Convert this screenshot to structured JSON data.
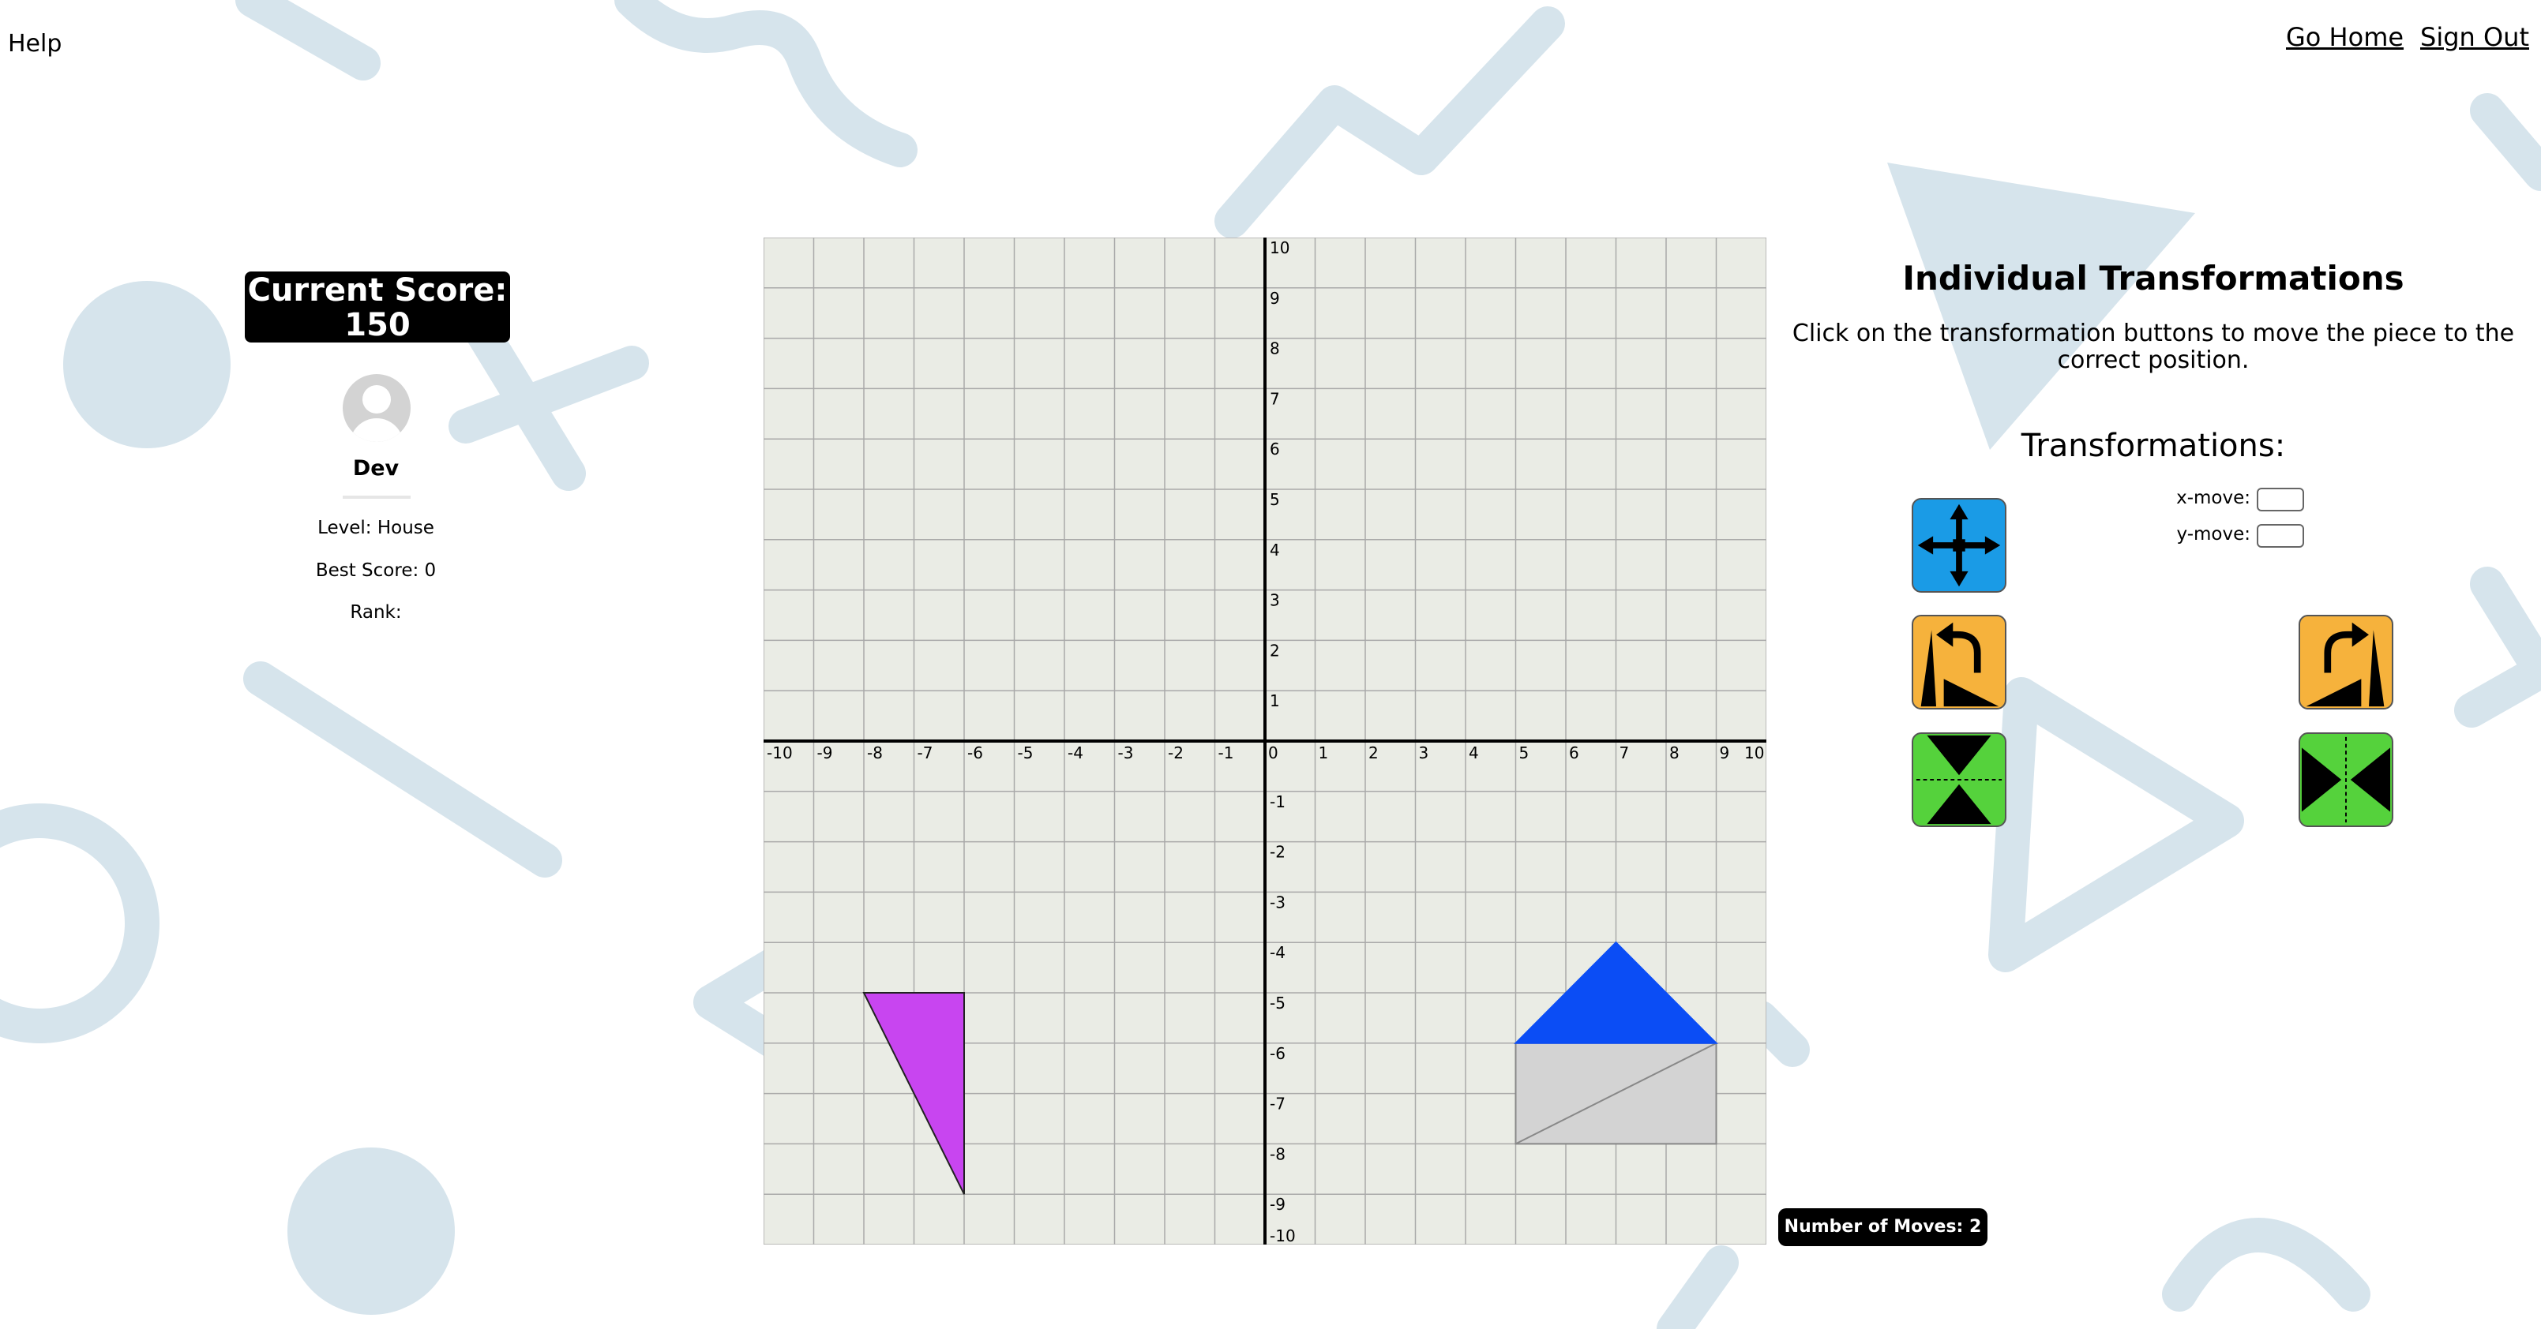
{
  "nav": {
    "help": "Help",
    "go_home": "Go Home",
    "sign_out": "Sign Out"
  },
  "player": {
    "score_title": "Current Score:",
    "score_value": "150",
    "name": "Dev",
    "level": "Level: House",
    "best_score": "Best Score: 0",
    "rank": "Rank:"
  },
  "panel": {
    "title": "Individual Transformations",
    "description": "Click on the transformation buttons to move the piece to the correct position.",
    "subtitle": "Transformations:",
    "x_move_label": "x-move:",
    "y_move_label": "y-move:",
    "x_move_value": "",
    "y_move_value": ""
  },
  "buttons": {
    "translate_icon": "move-arrows-icon",
    "rotate_ccw_icon": "rotate-left-icon",
    "rotate_cw_icon": "rotate-right-icon",
    "reflect_x_icon": "reflect-horizontal-axis-icon",
    "reflect_y_icon": "reflect-vertical-axis-icon",
    "translate_color": "#1a9be6",
    "rotate_color": "#f6b23c",
    "reflect_color": "#55d23c"
  },
  "moves": {
    "text": "Number of Moves: 2"
  },
  "board": {
    "x_range": [
      -10,
      10
    ],
    "y_range": [
      -10,
      10
    ],
    "grid_color": "#a9a9a9",
    "background": "#eaece5",
    "x_ticks": [
      "-10",
      "-9",
      "-8",
      "-7",
      "-6",
      "-5",
      "-4",
      "-3",
      "-2",
      "-1",
      "0",
      "1",
      "2",
      "3",
      "4",
      "5",
      "6",
      "7",
      "8",
      "9",
      "10"
    ],
    "y_ticks": [
      "10",
      "9",
      "8",
      "7",
      "6",
      "5",
      "4",
      "3",
      "2",
      "1",
      "-1",
      "-2",
      "-3",
      "-4",
      "-5",
      "-6",
      "-7",
      "-8",
      "-9",
      "-10"
    ],
    "target_roof": {
      "points": [
        [
          5,
          -6
        ],
        [
          7,
          -4
        ],
        [
          9,
          -6
        ]
      ],
      "color": "#0b4df5"
    },
    "target_body": {
      "points": [
        [
          5,
          -6
        ],
        [
          9,
          -6
        ],
        [
          9,
          -8
        ],
        [
          5,
          -8
        ]
      ],
      "color": "#d3d3d3",
      "diagonal": [
        [
          5,
          -8
        ],
        [
          9,
          -6
        ]
      ]
    },
    "piece": {
      "points": [
        [
          -8,
          -5
        ],
        [
          -6,
          -5
        ],
        [
          -6,
          -9
        ]
      ],
      "color": "#c845f0"
    }
  }
}
